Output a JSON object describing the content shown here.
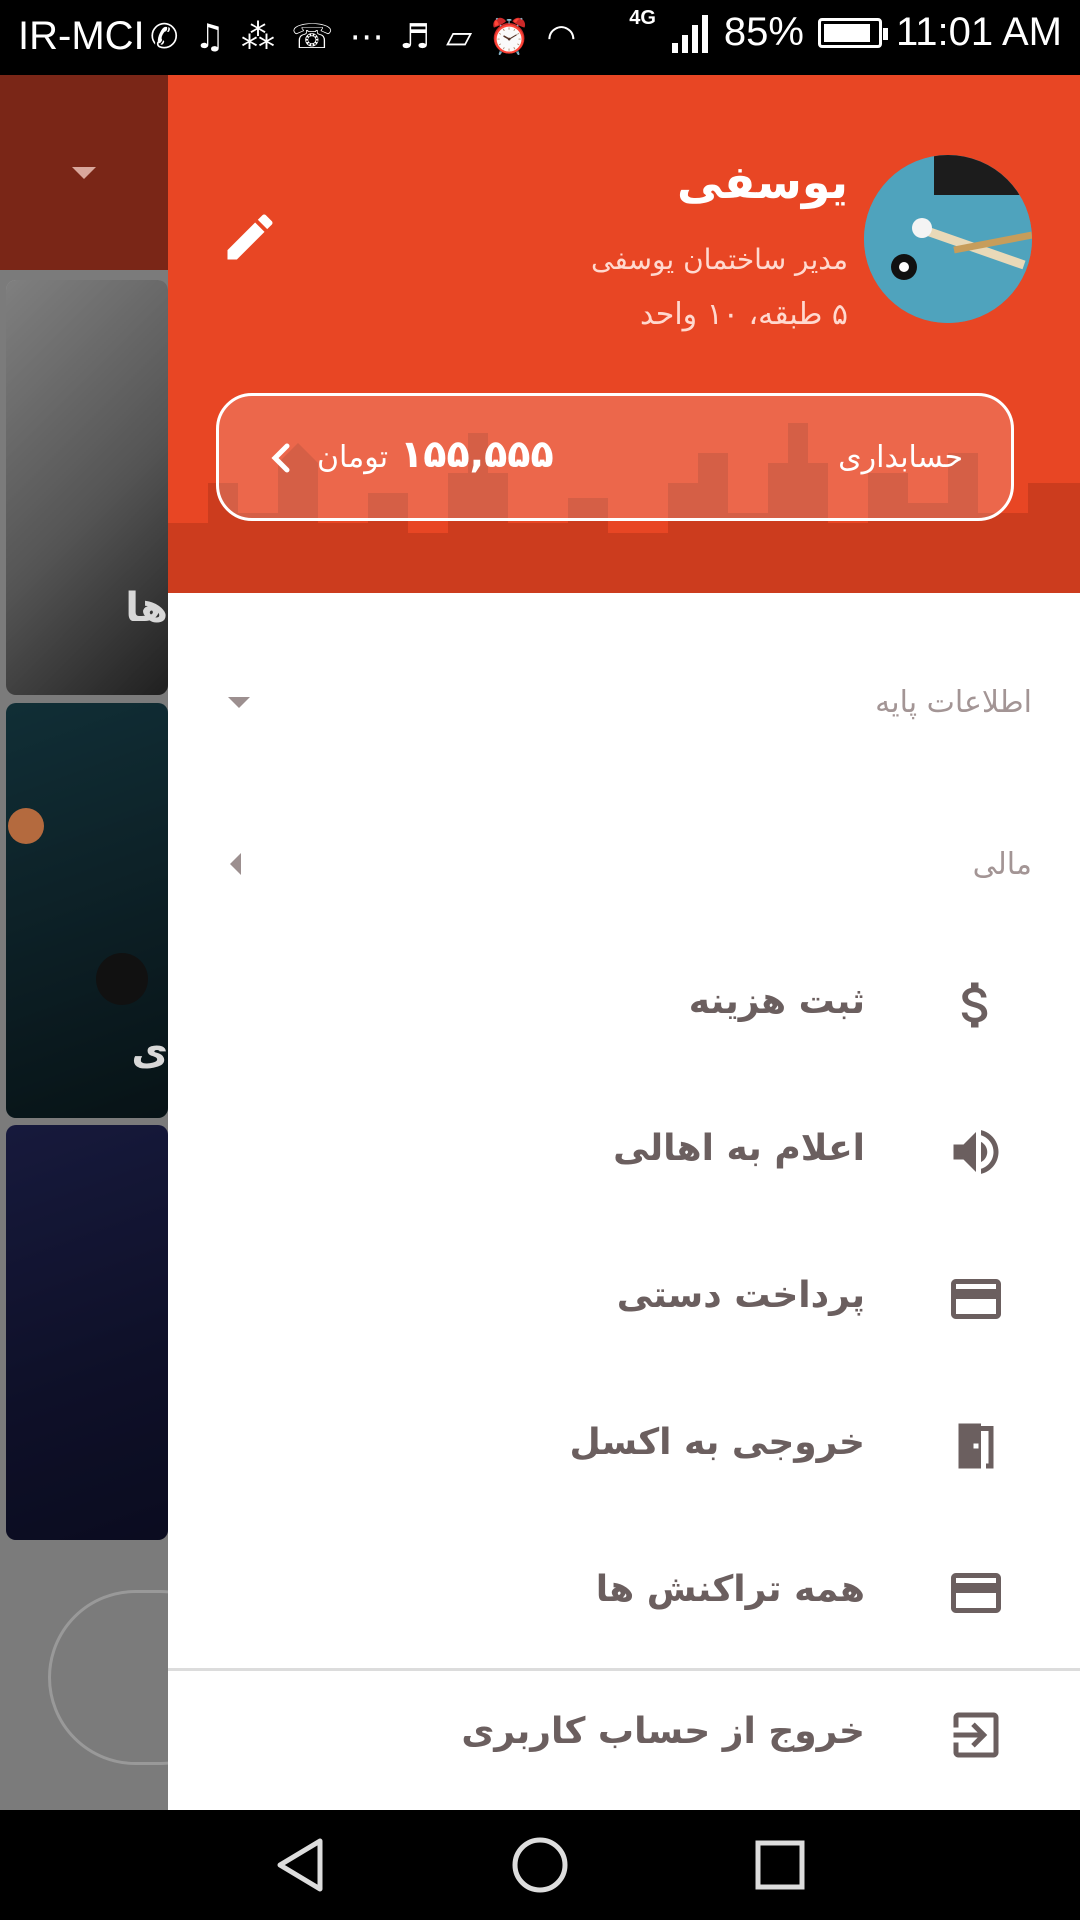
{
  "status_bar": {
    "carrier": "IR-MCI",
    "network": "4G",
    "battery": "85%",
    "time": "11:01 AM",
    "icons": [
      "whatsapp-icon",
      "headset-icon",
      "footsteps-icon",
      "missed-call-icon",
      "more-icon",
      "headphones-icon",
      "rotate-icon",
      "alarm-icon",
      "wifi-icon",
      "signal-icon",
      "battery-icon"
    ]
  },
  "background_app": {
    "card1_label": "ها",
    "card2_label": "ی"
  },
  "drawer": {
    "user": {
      "name": "یوسفی",
      "role": "مدیر ساختمان یوسفی",
      "units": "۵ طبقه، ۱۰ واحد"
    },
    "account": {
      "label": "حسابداری",
      "balance": "۱۵۵,۵۵۵",
      "currency": "تومان"
    },
    "sections": {
      "basic_info": "اطلاعات پایه",
      "financial": "مالی"
    },
    "menu_items": [
      {
        "label": "ثبت هزینه",
        "icon": "dollar-icon"
      },
      {
        "label": "اعلام به اهالی",
        "icon": "speaker-icon"
      },
      {
        "label": "پرداخت دستی",
        "icon": "credit-card-icon"
      },
      {
        "label": "خروجی به اکسل",
        "icon": "door-exit-icon"
      },
      {
        "label": "همه تراکنش ها",
        "icon": "credit-card-icon"
      }
    ],
    "logout": {
      "label": "خروج از حساب کاربری",
      "icon": "logout-icon"
    }
  },
  "colors": {
    "header": "#e84624",
    "menu_text": "#6b5f5f",
    "section_text": "#a39595"
  }
}
